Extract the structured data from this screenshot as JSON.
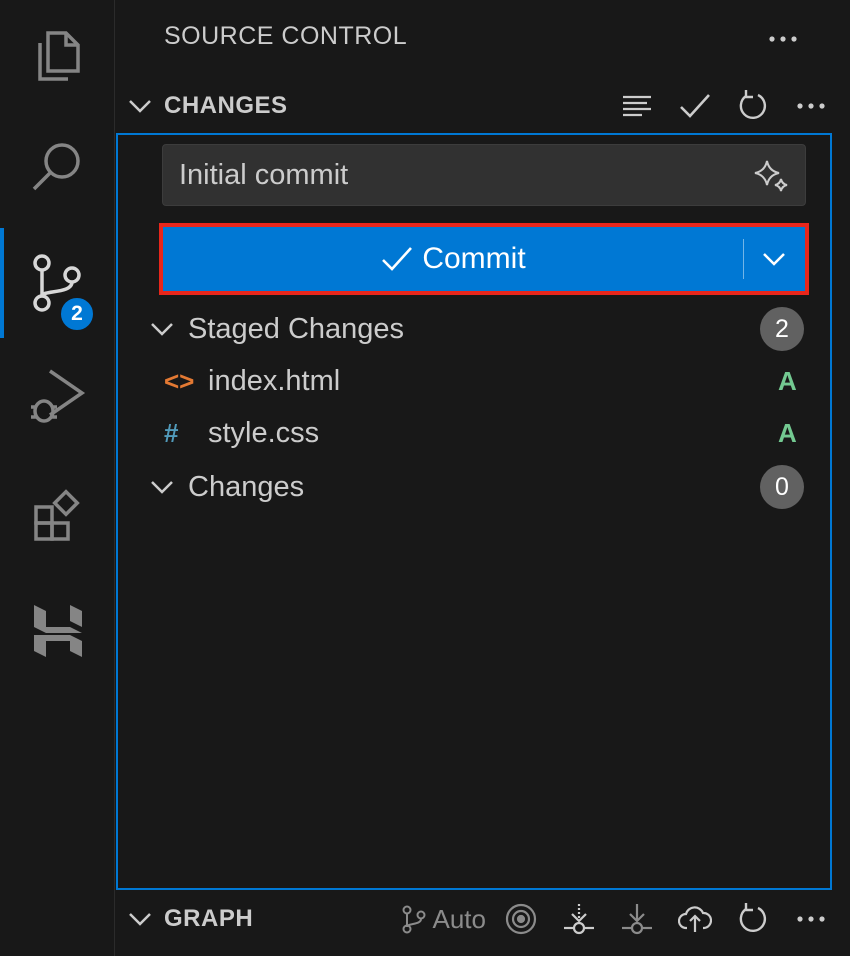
{
  "activity_bar": {
    "items": [
      {
        "name": "explorer"
      },
      {
        "name": "search"
      },
      {
        "name": "source-control",
        "badge": "2"
      },
      {
        "name": "run-and-debug"
      },
      {
        "name": "extensions"
      },
      {
        "name": "hostinger"
      }
    ]
  },
  "sidebar": {
    "title": "SOURCE CONTROL",
    "changes_section": {
      "label": "CHANGES",
      "commit_message": "Initial commit",
      "commit_button_label": "Commit",
      "staged": {
        "label": "Staged Changes",
        "count": "2",
        "files": [
          {
            "icon": "<>",
            "name": "index.html",
            "status": "A",
            "icon_color": "#e37933"
          },
          {
            "icon": "#",
            "name": "style.css",
            "status": "A",
            "icon_color": "#519aba"
          }
        ]
      },
      "changes": {
        "label": "Changes",
        "count": "0"
      }
    },
    "graph_section": {
      "label": "GRAPH",
      "auto_label": "Auto"
    }
  },
  "colors": {
    "accent": "#0078d4",
    "highlight_border": "#e8261b",
    "status_added": "#73c991"
  }
}
